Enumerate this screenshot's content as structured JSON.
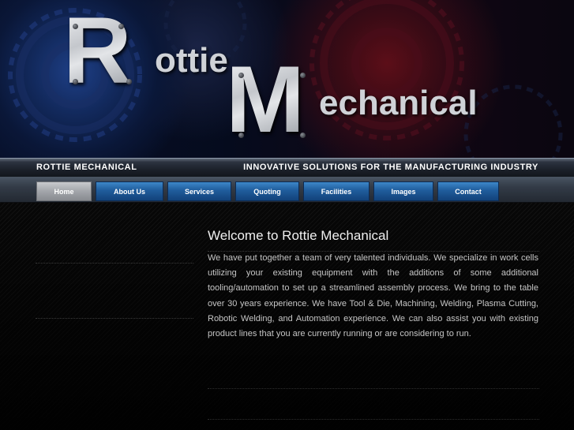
{
  "logo": {
    "word1_initial": "R",
    "word1_rest": "ottie",
    "word2_initial": "M",
    "word2_rest": "echanical"
  },
  "topbar": {
    "company_name": "ROTTIE MECHANICAL",
    "tagline": "INNOVATIVE SOLUTIONS FOR THE MANUFACTURING INDUSTRY"
  },
  "nav": {
    "items": [
      {
        "label": "Home",
        "active": true
      },
      {
        "label": "About Us"
      },
      {
        "label": "Services"
      },
      {
        "label": "Quoting"
      },
      {
        "label": "Facilities"
      },
      {
        "label": "Images"
      },
      {
        "label": "Contact"
      }
    ]
  },
  "main": {
    "title": "Welcome to Rottie Mechanical",
    "body": "We have put together a team of very talented individuals. We specialize in work cells utilizing your existing equipment with the additions of some additional tooling/automation to set up a streamlined assembly process.  We bring to the table over 30 years experience.  We have Tool & Die, Machining, Welding, Plasma Cutting, Robotic Welding, and Automation experience.  We can also assist you with existing product lines that you are currently running or are considering to run."
  },
  "colors": {
    "nav_tab": "#1f5c9c",
    "nav_tab_active": "#a2a5aa",
    "background": "#050505",
    "title_text": "#f0f0f0",
    "body_text": "#c6c6c6"
  }
}
